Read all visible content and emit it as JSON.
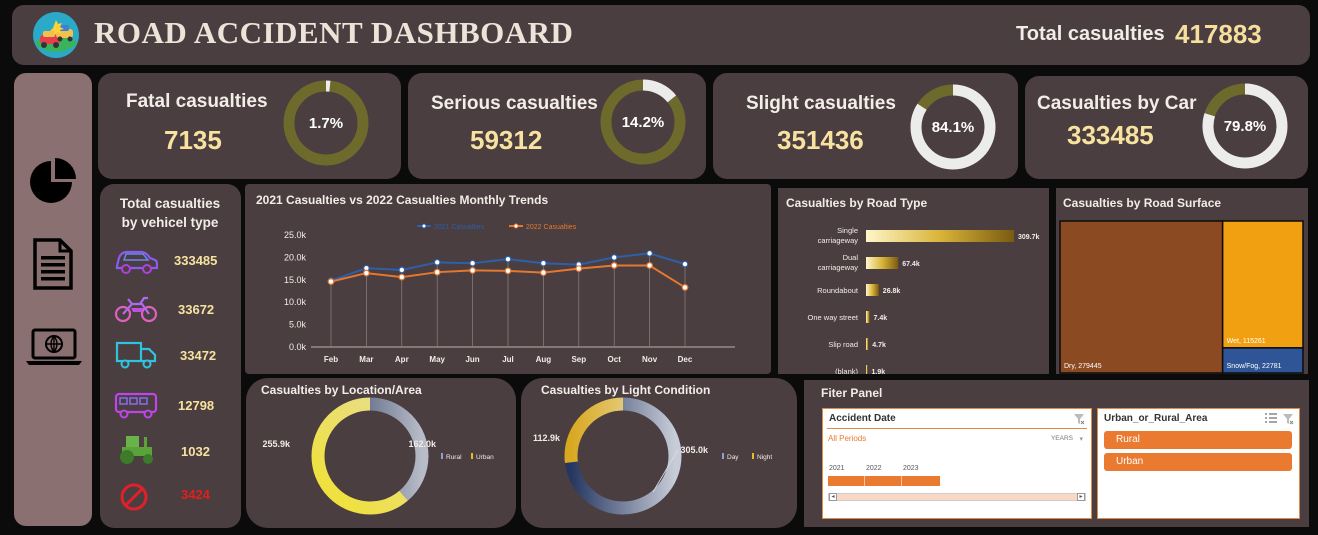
{
  "header": {
    "title": "ROAD ACCIDENT DASHBOARD",
    "total_label": "Total casualties",
    "total_value": "417883"
  },
  "sidebar": {
    "icons": [
      "pie-chart-icon",
      "document-icon",
      "laptop-globe-icon"
    ]
  },
  "kpis": [
    {
      "label": "Fatal casualties",
      "value": "7135",
      "pct_text": "1.7%",
      "pct": 0.017
    },
    {
      "label": "Serious casualties",
      "value": "59312",
      "pct_text": "14.2%",
      "pct": 0.142
    },
    {
      "label": "Slight casualties",
      "value": "351436",
      "pct_text": "84.1%",
      "pct": 0.841
    },
    {
      "label": "Casualties by Car",
      "value": "333485",
      "pct_text": "79.8%",
      "pct": 0.798
    }
  ],
  "vehicles": {
    "title_line1": "Total casualties",
    "title_line2": "by vehicel type",
    "items": [
      {
        "icon": "car-icon",
        "value": "333485",
        "color": "#f8e2a0"
      },
      {
        "icon": "motorcycle-icon",
        "value": "33672",
        "color": "#f8e2a0"
      },
      {
        "icon": "truck-icon",
        "value": "33472",
        "color": "#f8e2a0"
      },
      {
        "icon": "bus-icon",
        "value": "12798",
        "color": "#f8e2a0"
      },
      {
        "icon": "tractor-icon",
        "value": "1032",
        "color": "#f8e2a0"
      },
      {
        "icon": "prohibited-icon",
        "value": "3424",
        "color": "#e02020"
      }
    ]
  },
  "colors": {
    "background": "#0b0b0b",
    "card": "#4a3e40",
    "gold": "#f8e2a0",
    "ring_track": "#6e6a2c",
    "blue_series": "#2e5fa8",
    "orange_series": "#e5782f"
  },
  "chart_data": [
    {
      "type": "line",
      "title": "2021 Casualties vs 2022 Casualties Monthly Trends",
      "categories": [
        "Feb",
        "Mar",
        "Apr",
        "May",
        "Jun",
        "Jul",
        "Aug",
        "Sep",
        "Oct",
        "Nov",
        "Dec"
      ],
      "series": [
        {
          "name": "2021 Casualties",
          "values": [
            14.8,
            17.6,
            17.2,
            18.9,
            18.7,
            19.6,
            18.7,
            18.4,
            20.0,
            20.9,
            18.5
          ]
        },
        {
          "name": "2022 Casualties",
          "values": [
            14.6,
            16.5,
            15.6,
            16.7,
            17.1,
            17.0,
            16.6,
            17.5,
            18.2,
            18.2,
            13.3
          ]
        }
      ],
      "yticks": [
        "0.0k",
        "5.0k",
        "10.0k",
        "15.0k",
        "20.0k",
        "25.0k"
      ],
      "ylim": [
        0,
        25
      ],
      "legend": "top",
      "grid": false
    },
    {
      "type": "bar",
      "title": "Casualties by Road Type",
      "categories": [
        "Single carriageway",
        "Dual carriageway",
        "Roundabout",
        "One way street",
        "Slip road",
        "(blank)"
      ],
      "values": [
        309.7,
        67.4,
        26.8,
        7.4,
        4.7,
        1.9
      ],
      "labels": [
        "309.7k",
        "67.4k",
        "26.8k",
        "7.4k",
        "4.7k",
        "1.9k"
      ],
      "orientation": "horizontal"
    },
    {
      "type": "treemap",
      "title": "Casualties by Road Surface",
      "items": [
        {
          "label": "Dry, 279445",
          "value": 279445,
          "color": "#8b4a22"
        },
        {
          "label": "Wet, 115261",
          "value": 115261,
          "color": "#f0a010"
        },
        {
          "label": "Snow/Fog, 22781",
          "value": 22781,
          "color": "#2f5597"
        }
      ]
    },
    {
      "type": "donut",
      "title": "Casualties by Location/Area",
      "slices": [
        {
          "name": "Rural",
          "value": 162.0,
          "label": "162.0k"
        },
        {
          "name": "Urban",
          "value": 255.9,
          "label": "255.9k"
        }
      ],
      "legend": "right"
    },
    {
      "type": "donut",
      "title": "Casualties by Light Condition",
      "slices": [
        {
          "name": "Day",
          "value": 305.0,
          "label": "305.0k"
        },
        {
          "name": "Night",
          "value": 112.9,
          "label": "112.9k"
        }
      ],
      "legend": "right"
    }
  ],
  "filter_panel": {
    "title": "Fiter Panel",
    "date_slicer": {
      "title": "Accident Date",
      "period": "All Periods",
      "granularity": "YEARS",
      "years": [
        "2021",
        "2022",
        "2023"
      ]
    },
    "area_slicer": {
      "title": "Urban_or_Rural_Area",
      "options": [
        "Rural",
        "Urban"
      ]
    }
  }
}
